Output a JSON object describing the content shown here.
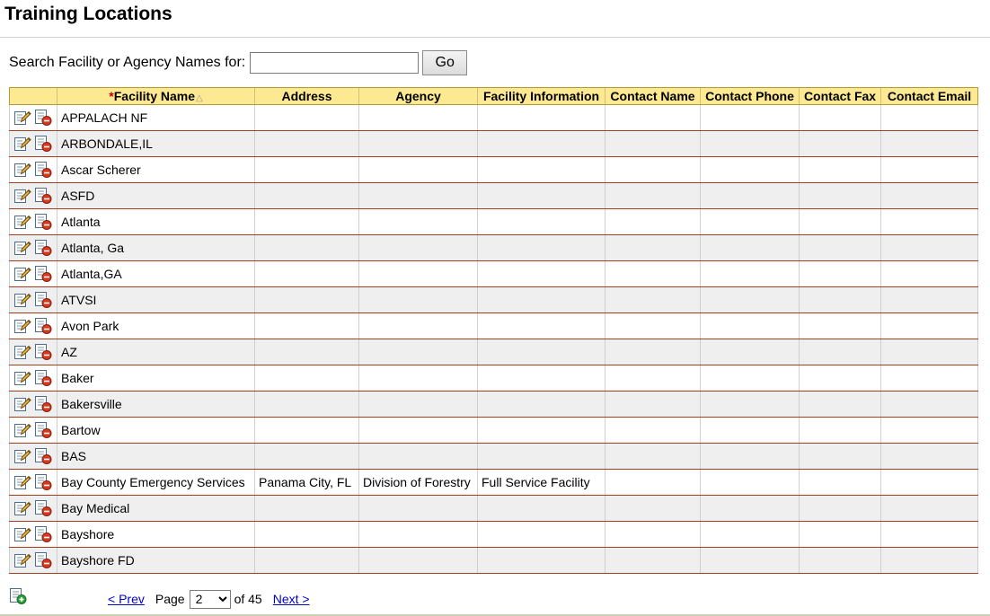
{
  "page": {
    "title": "Training Locations"
  },
  "search": {
    "label": "Search Facility or Agency Names for:",
    "value": "",
    "placeholder": "",
    "go_label": "Go"
  },
  "table": {
    "columns": {
      "required_marker": "*",
      "facility_name": "Facility Name",
      "sort_glyph": "△",
      "address": "Address",
      "agency": "Agency",
      "facility_information": "Facility Information",
      "contact_name": "Contact Name",
      "contact_phone": "Contact Phone",
      "contact_fax": "Contact Fax",
      "contact_email": "Contact Email"
    },
    "rows": [
      {
        "name": "APPALACH NF",
        "address": "",
        "agency": "",
        "info": "",
        "contact_name": "",
        "phone": "",
        "fax": "",
        "email": ""
      },
      {
        "name": "ARBONDALE,IL",
        "address": "",
        "agency": "",
        "info": "",
        "contact_name": "",
        "phone": "",
        "fax": "",
        "email": ""
      },
      {
        "name": "Ascar Scherer",
        "address": "",
        "agency": "",
        "info": "",
        "contact_name": "",
        "phone": "",
        "fax": "",
        "email": ""
      },
      {
        "name": "ASFD",
        "address": "",
        "agency": "",
        "info": "",
        "contact_name": "",
        "phone": "",
        "fax": "",
        "email": ""
      },
      {
        "name": "Atlanta",
        "address": "",
        "agency": "",
        "info": "",
        "contact_name": "",
        "phone": "",
        "fax": "",
        "email": ""
      },
      {
        "name": "Atlanta, Ga",
        "address": "",
        "agency": "",
        "info": "",
        "contact_name": "",
        "phone": "",
        "fax": "",
        "email": ""
      },
      {
        "name": "Atlanta,GA",
        "address": "",
        "agency": "",
        "info": "",
        "contact_name": "",
        "phone": "",
        "fax": "",
        "email": ""
      },
      {
        "name": "ATVSI",
        "address": "",
        "agency": "",
        "info": "",
        "contact_name": "",
        "phone": "",
        "fax": "",
        "email": ""
      },
      {
        "name": "Avon Park",
        "address": "",
        "agency": "",
        "info": "",
        "contact_name": "",
        "phone": "",
        "fax": "",
        "email": ""
      },
      {
        "name": "AZ",
        "address": "",
        "agency": "",
        "info": "",
        "contact_name": "",
        "phone": "",
        "fax": "",
        "email": ""
      },
      {
        "name": "Baker",
        "address": "",
        "agency": "",
        "info": "",
        "contact_name": "",
        "phone": "",
        "fax": "",
        "email": ""
      },
      {
        "name": "Bakersville",
        "address": "",
        "agency": "",
        "info": "",
        "contact_name": "",
        "phone": "",
        "fax": "",
        "email": ""
      },
      {
        "name": "Bartow",
        "address": "",
        "agency": "",
        "info": "",
        "contact_name": "",
        "phone": "",
        "fax": "",
        "email": ""
      },
      {
        "name": "BAS",
        "address": "",
        "agency": "",
        "info": "",
        "contact_name": "",
        "phone": "",
        "fax": "",
        "email": ""
      },
      {
        "name": "Bay County Emergency Services",
        "address": "Panama City, FL",
        "agency": "Division of Forestry",
        "info": "Full Service Facility",
        "contact_name": "",
        "phone": "",
        "fax": "",
        "email": ""
      },
      {
        "name": "Bay Medical",
        "address": "",
        "agency": "",
        "info": "",
        "contact_name": "",
        "phone": "",
        "fax": "",
        "email": ""
      },
      {
        "name": "Bayshore",
        "address": "",
        "agency": "",
        "info": "",
        "contact_name": "",
        "phone": "",
        "fax": "",
        "email": ""
      },
      {
        "name": "Bayshore FD",
        "address": "",
        "agency": "",
        "info": "",
        "contact_name": "",
        "phone": "",
        "fax": "",
        "email": ""
      }
    ]
  },
  "pager": {
    "prev_label": "< Prev",
    "page_label": "Page",
    "current_page": "2",
    "of_label": "of 45",
    "next_label": "Next >"
  },
  "icons": {
    "edit": "edit-record-icon",
    "delete": "delete-record-icon",
    "add": "add-record-icon"
  },
  "colors": {
    "header_bg": "#fde992",
    "row_rule": "#a93c1a",
    "alt_row_bg": "#efefef",
    "link": "#0000cc"
  }
}
